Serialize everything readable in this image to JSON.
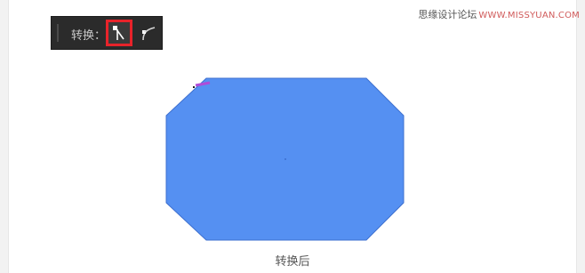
{
  "watermark": {
    "site_name": "思缘设计论坛",
    "site_url": "WWW.MISSYUAN.COM"
  },
  "toolbar": {
    "label": "转换：",
    "buttons": [
      {
        "name": "convert-to-corner",
        "icon": "corner-anchor-icon",
        "selected": true
      },
      {
        "name": "convert-to-smooth",
        "icon": "smooth-anchor-icon",
        "selected": false
      }
    ]
  },
  "canvas": {
    "shape": "octagon",
    "fill_color": "#5590f2",
    "selected_anchor_color": "#b04cd8"
  },
  "caption": "转换后"
}
